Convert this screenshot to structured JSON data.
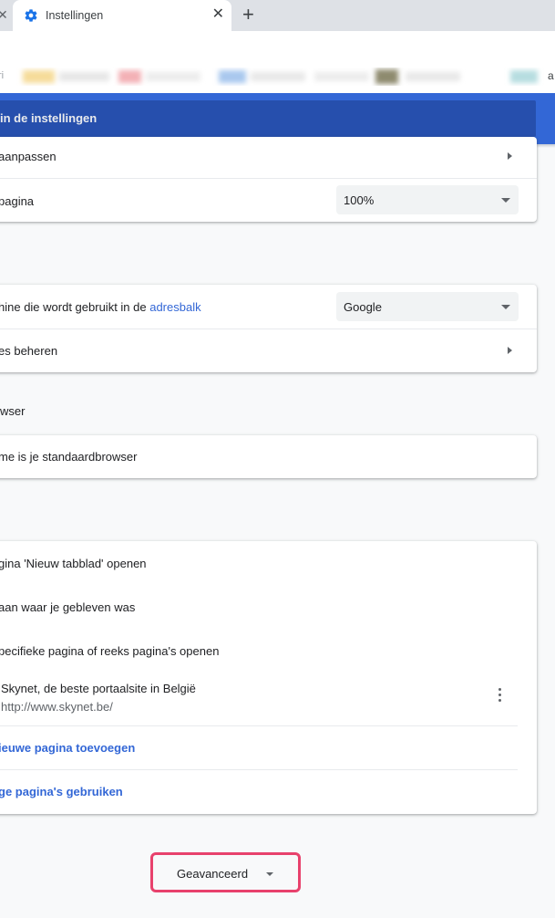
{
  "browser": {
    "tab_title": "Instellingen",
    "tab_close": "✕",
    "prev_tab_close": "✕",
    "new_tab": "+",
    "bookmarks_left_text": "ri",
    "bookmarks_right_text": "a"
  },
  "header": {
    "search_text": "in de instellingen"
  },
  "appearance": {
    "customize_fonts_label": "aanpassen",
    "zoom_label": "pagina",
    "zoom_value": "100%"
  },
  "search_engine": {
    "engine_label_prefix": "hine die wordt gebruikt in de ",
    "engine_label_link": "adresbalk",
    "engine_value": "Google",
    "manage_label": "es beheren"
  },
  "default_browser": {
    "section_title": "wser",
    "status": "me is je standaardbrowser"
  },
  "on_startup": {
    "option_new_tab": "gina 'Nieuw tabblad' openen",
    "option_continue": "aan waar je gebleven was",
    "option_specific": "pecifieke pagina of reeks pagina's openen",
    "page_title": "Skynet, de beste portaalsite in België",
    "page_url": "http://www.skynet.be/",
    "add_page": "ieuwe pagina toevoegen",
    "use_current": "ge pagina's gebruiken"
  },
  "advanced": {
    "label": "Geavanceerd"
  },
  "colors": {
    "accent": "#3367d6",
    "header_bg": "#3367d6",
    "search_bg": "#264fad",
    "highlight": "#e8416c"
  }
}
